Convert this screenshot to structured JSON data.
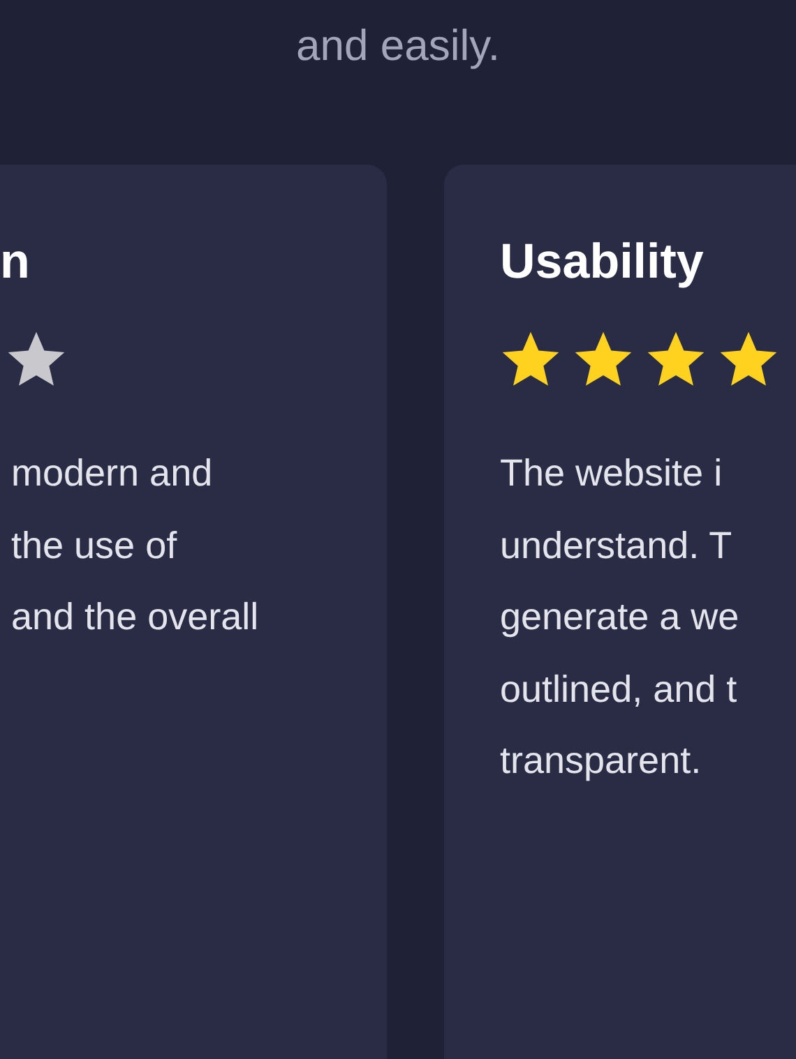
{
  "intro_text": "and easily.",
  "cards": [
    {
      "title": "n",
      "rating": [
        {
          "filled": false
        }
      ],
      "description_lines": [
        "modern and",
        "the use of",
        "and the overall"
      ]
    },
    {
      "title": "Usability",
      "rating": [
        {
          "filled": true
        },
        {
          "filled": true
        },
        {
          "filled": true
        },
        {
          "filled": true
        }
      ],
      "description_lines": [
        "The website i",
        "understand. T",
        "generate a we",
        "outlined, and t",
        "transparent."
      ]
    }
  ]
}
